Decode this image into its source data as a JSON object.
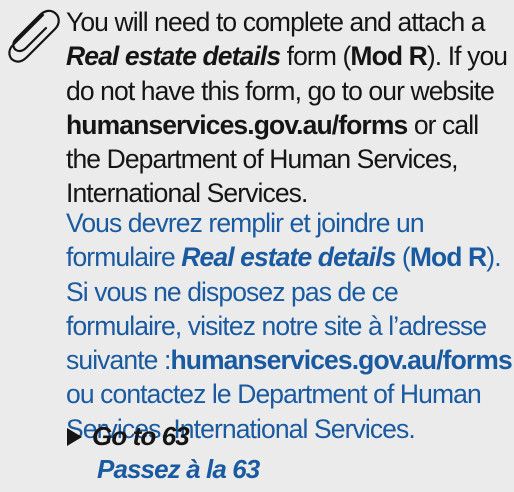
{
  "icon": "paperclip-icon",
  "english": {
    "line1": "You will need to complete and attach a",
    "line2_form": "Real estate details",
    "line2_mid": " form (",
    "line2_mod": "Mod R",
    "line2_end": "). If you",
    "line3": "do not have this form, go to our website",
    "line4_url": "humanservices.gov.au/forms",
    "line4_end": " or call",
    "line5": "the Department of Human Services,",
    "line6": "International Services."
  },
  "french": {
    "line1": "Vous devrez remplir et joindre un",
    "line2_start": "formulaire ",
    "line2_form": "Real estate details",
    "line2_open": " (",
    "line2_mod": "Mod R",
    "line2_end": ").",
    "line3": "Si vous ne disposez pas de ce",
    "line4": "formulaire, visitez notre site à l’adresse",
    "line5_start": "suivante :",
    "line5_url": "humanservices.gov.au/forms",
    "line6": "ou contactez le Department of Human",
    "line7": "Services, International Services."
  },
  "goto": {
    "english": "Go to 63",
    "french": "Passez à la 63"
  },
  "colors": {
    "background": "#ebebeb",
    "english_text": "#151515",
    "french_text": "#1a5aa0"
  }
}
